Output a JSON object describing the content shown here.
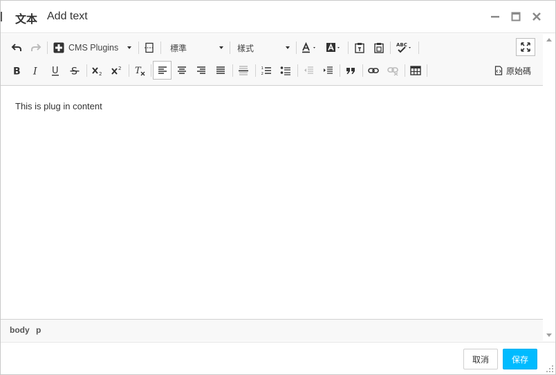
{
  "dialog": {
    "title_cn": "文本",
    "title_en": "Add text"
  },
  "toolbar": {
    "cms_plugins_label": "CMS Plugins",
    "format_combo_label": "標準",
    "style_combo_label": "樣式",
    "source_label": "原始碼"
  },
  "content": {
    "text": "This is plug in content"
  },
  "pathbar": {
    "items": [
      "body",
      "p"
    ]
  },
  "footer": {
    "cancel_label": "取消",
    "save_label": "保存"
  },
  "colors": {
    "accent": "#00bbff",
    "toolbar_bg": "#f8f8f8",
    "border": "#d1d1d1"
  }
}
